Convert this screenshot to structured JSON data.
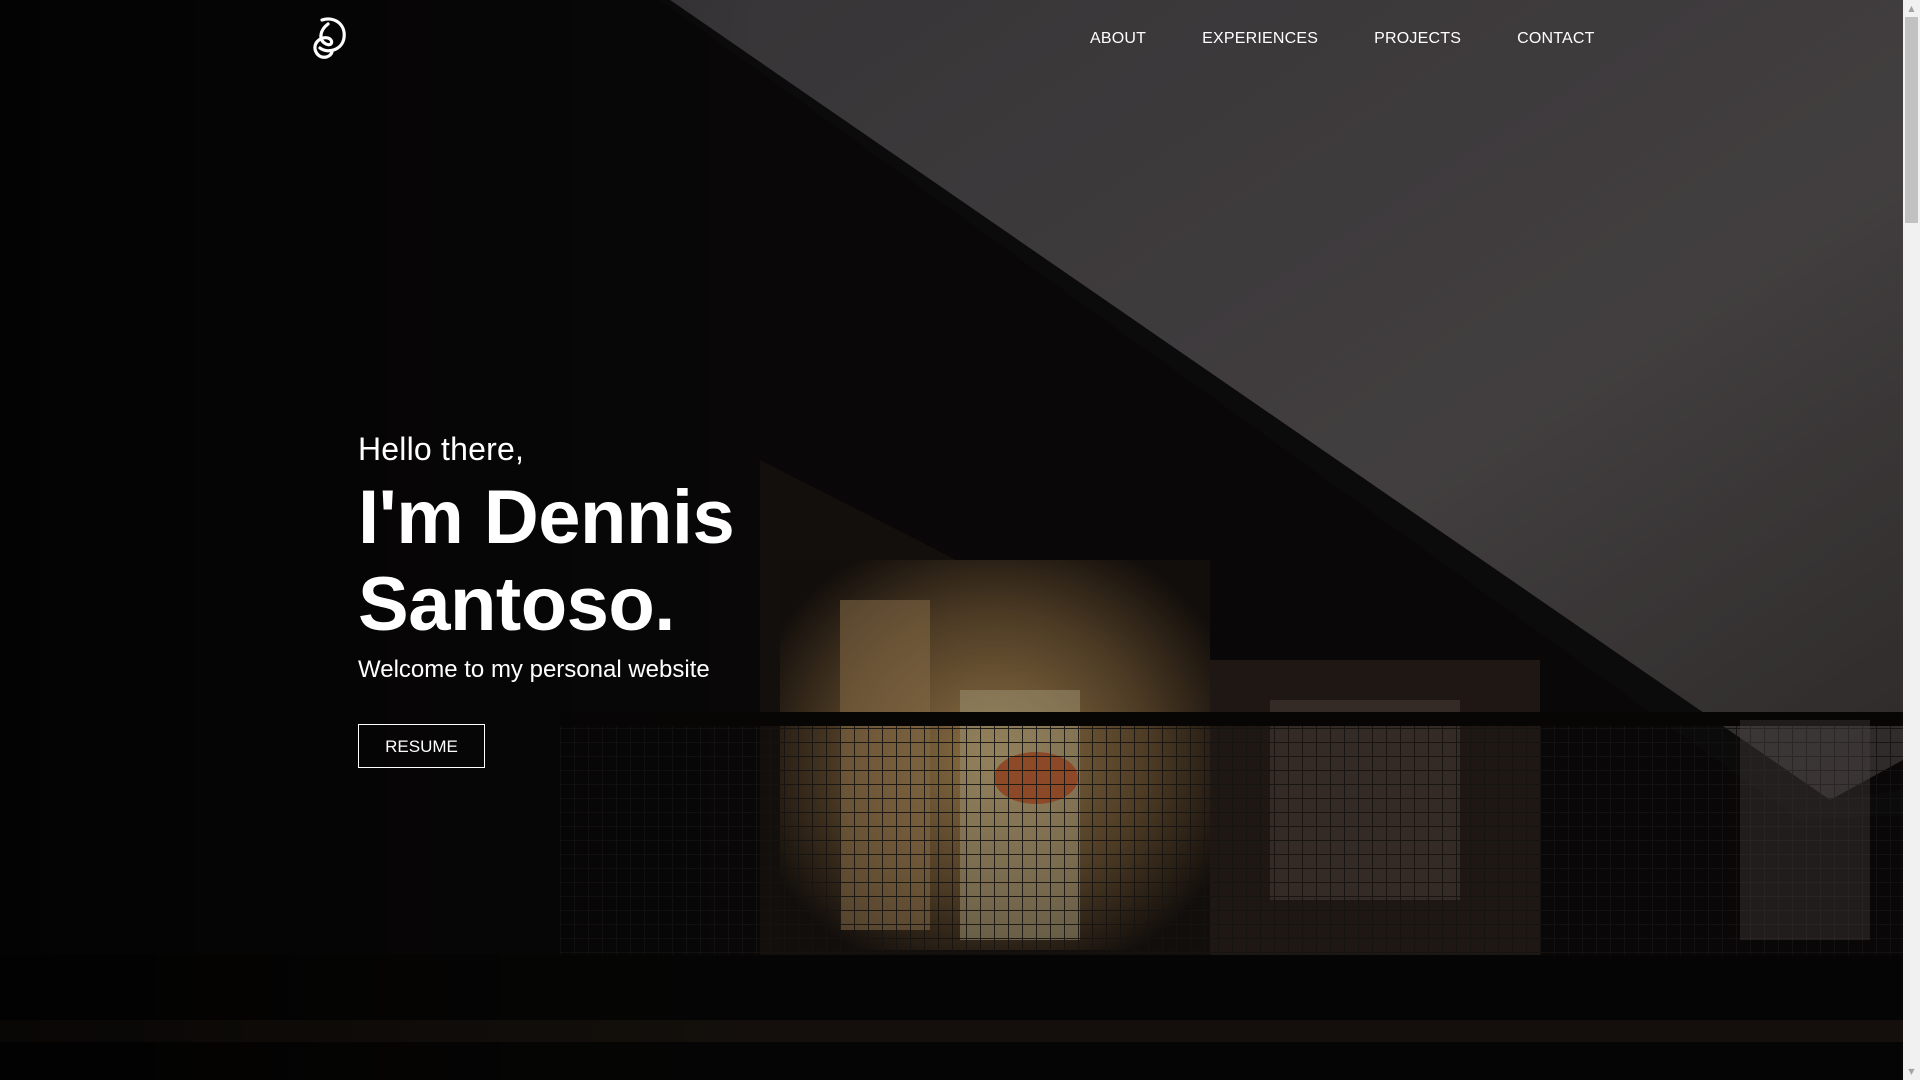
{
  "nav": {
    "items": [
      {
        "label": "ABOUT"
      },
      {
        "label": "EXPERIENCES"
      },
      {
        "label": "PROJECTS"
      },
      {
        "label": "CONTACT"
      }
    ]
  },
  "hero": {
    "greeting": "Hello there,",
    "name_line1": "I'm Dennis",
    "name_line2": "Santoso.",
    "subtitle": "Welcome to my personal website",
    "button_label": "RESUME"
  },
  "icons": {
    "logo": "ds-monogram-logo",
    "scroll_up": "scroll-up-arrow-icon",
    "scroll_down": "scroll-down-arrow-icon"
  },
  "colors": {
    "text": "#ffffff",
    "overlay": "#000000",
    "sky": "#5a5658",
    "warm_light": "#c9a468"
  }
}
